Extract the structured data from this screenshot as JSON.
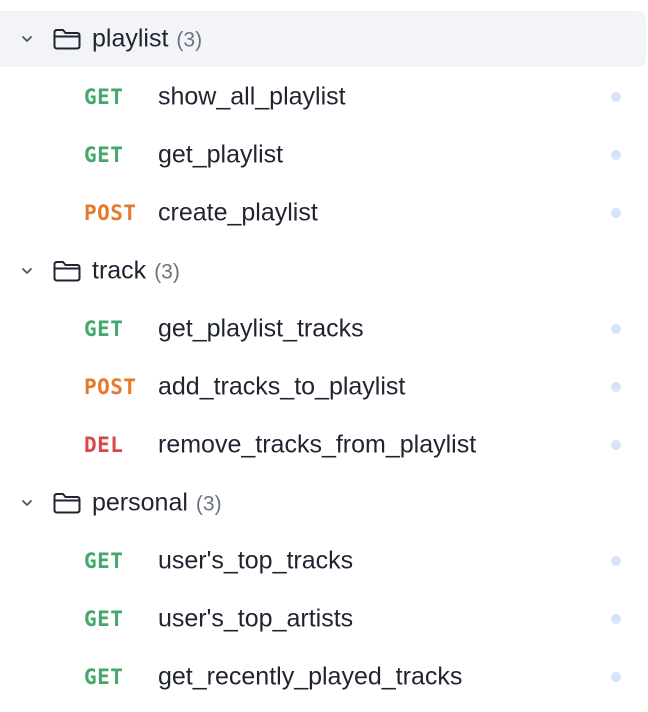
{
  "colors": {
    "get": "#43a86b",
    "post": "#e57a2e",
    "del": "#d9474a",
    "selected_bg": "#f3f4f7",
    "status_dot": "#d6e2f6"
  },
  "folders": [
    {
      "name": "playlist",
      "count": "(3)",
      "selected": true,
      "chevron_icon": "chevron-down-icon",
      "folder_icon": "folder-icon",
      "requests": [
        {
          "method": "GET",
          "name": "show_all_playlist"
        },
        {
          "method": "GET",
          "name": "get_playlist"
        },
        {
          "method": "POST",
          "name": "create_playlist"
        }
      ]
    },
    {
      "name": "track",
      "count": "(3)",
      "selected": false,
      "chevron_icon": "chevron-down-icon",
      "folder_icon": "folder-icon",
      "requests": [
        {
          "method": "GET",
          "name": "get_playlist_tracks"
        },
        {
          "method": "POST",
          "name": "add_tracks_to_playlist"
        },
        {
          "method": "DEL",
          "name": "remove_tracks_from_playlist"
        }
      ]
    },
    {
      "name": "personal",
      "count": "(3)",
      "selected": false,
      "chevron_icon": "chevron-down-icon",
      "folder_icon": "folder-icon",
      "requests": [
        {
          "method": "GET",
          "name": "user's_top_tracks"
        },
        {
          "method": "GET",
          "name": "user's_top_artists"
        },
        {
          "method": "GET",
          "name": "get_recently_played_tracks"
        }
      ]
    }
  ]
}
